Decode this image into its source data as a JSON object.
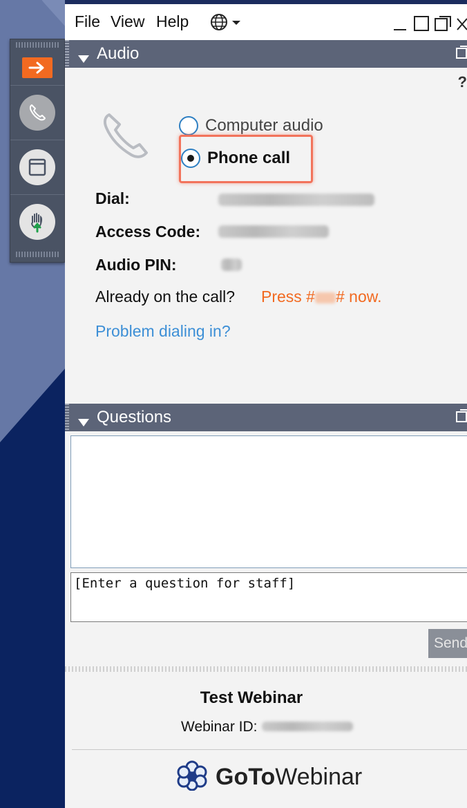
{
  "menu": {
    "file": "File",
    "view": "View",
    "help": "Help"
  },
  "audio_panel": {
    "title": "Audio",
    "help_mark": "?",
    "options": {
      "computer_audio": "Computer audio",
      "phone_call": "Phone call",
      "selected": "phone_call"
    },
    "dial_label": "Dial:",
    "access_code_label": "Access Code:",
    "audio_pin_label": "Audio PIN:",
    "already_on_call": "Already on the call?",
    "press_prefix": "Press #",
    "press_suffix": "# now.",
    "problem_link": "Problem dialing in?"
  },
  "questions_panel": {
    "title": "Questions",
    "input_value": "[Enter a question for staff]",
    "send_label": "Send"
  },
  "footer": {
    "webinar_title": "Test Webinar",
    "webinar_id_label": "Webinar ID:",
    "logo_goto": "GoTo",
    "logo_webinar": "Webinar"
  },
  "colors": {
    "accent_orange": "#f26a21",
    "link_blue": "#3d8fd6",
    "header_gray": "#5c6478",
    "background_navy": "#0b2360",
    "highlight_red": "#f2735b"
  },
  "icons": {
    "sidebar": [
      "arrow-right-icon",
      "phone-icon",
      "window-icon",
      "raise-hand-icon"
    ],
    "menu": [
      "globe-icon",
      "minimize-icon",
      "maximize-icon",
      "popout-icon",
      "close-icon"
    ],
    "panel": [
      "collapse-triangle-icon",
      "popout-icon"
    ],
    "audio": [
      "phone-handset-icon"
    ],
    "logo": [
      "gotowebinar-flower-icon"
    ]
  }
}
